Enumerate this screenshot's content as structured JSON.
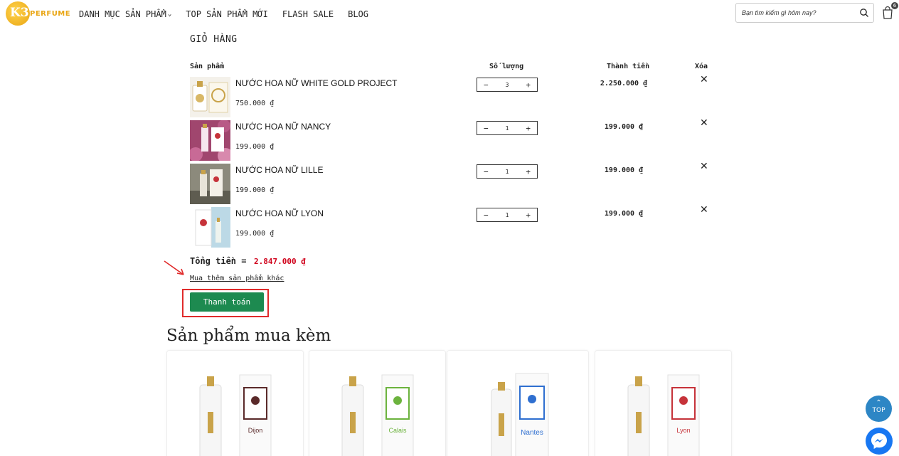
{
  "header": {
    "logo_text": "PERFUME",
    "logo_mark": "K3",
    "nav": [
      {
        "label": "DANH MỤC SẢN PHẨM",
        "has_dropdown": true
      },
      {
        "label": "TOP SẢN PHẨM MỚI"
      },
      {
        "label": "FLASH SALE"
      },
      {
        "label": "BLOG"
      }
    ],
    "search_placeholder": "Bạn tìm kiếm gì hôm nay?",
    "cart_count": "6"
  },
  "cart": {
    "title": "GIỎ HÀNG",
    "columns": {
      "product": "Sản phẩm",
      "qty": "Số lượng",
      "total": "Thành tiền",
      "delete": "Xóa"
    },
    "items": [
      {
        "name": "NƯỚC HOA NỮ WHITE GOLD PROJECT",
        "price": "750.000 ₫",
        "qty": "3",
        "total": "2.250.000 ₫"
      },
      {
        "name": "NƯỚC HOA NỮ NANCY",
        "price": "199.000 ₫",
        "qty": "1",
        "total": "199.000 ₫"
      },
      {
        "name": "NƯỚC HOA NỮ LILLE",
        "price": "199.000 ₫",
        "qty": "1",
        "total": "199.000 ₫"
      },
      {
        "name": "NƯỚC HOA NỮ LYON",
        "price": "199.000 ₫",
        "qty": "1",
        "total": "199.000 ₫"
      }
    ],
    "sum_label": "Tổng tiền =",
    "sum_value": "2.847.000 ₫",
    "more_link": "Mua thêm sản phẩm khác",
    "pay_button": "Thanh toán"
  },
  "related": {
    "title": "Sản phẩm mua kèm",
    "products": [
      {
        "label": "Dijon",
        "color": "#5a2a2a"
      },
      {
        "label": "Calais",
        "color": "#6cb33e"
      },
      {
        "label": "Nantes",
        "color": "#2f6fd0"
      },
      {
        "label": "Lyon",
        "color": "#c6333a"
      }
    ]
  },
  "floating": {
    "top_label": "TOP"
  },
  "colors": {
    "accent_green": "#1d8a50",
    "price_red": "#d0021b",
    "highlight": "#e02b2b",
    "top_blue": "#2d86c5",
    "messenger": "#1877f2"
  }
}
